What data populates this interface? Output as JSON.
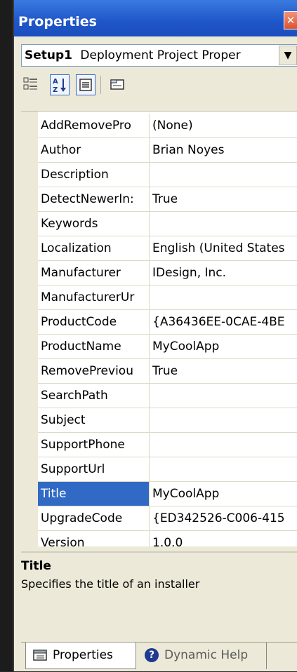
{
  "window": {
    "title": "Properties",
    "close_glyph": "✕"
  },
  "selector": {
    "object": "Setup1",
    "type": "Deployment Project Proper"
  },
  "toolbar": {
    "buttons": [
      {
        "name": "categorized-button",
        "icon": "categorized-icon"
      },
      {
        "name": "alphabetical-button",
        "icon": "alphabetical-icon",
        "glyph": "A↓Z"
      },
      {
        "name": "properties-view-button",
        "icon": "properties-view-icon"
      },
      {
        "name": "property-pages-button",
        "icon": "property-pages-icon"
      }
    ]
  },
  "grid": {
    "rows": [
      {
        "name": "AddRemovePro",
        "value": "(None)"
      },
      {
        "name": "Author",
        "value": "Brian Noyes"
      },
      {
        "name": "Description",
        "value": ""
      },
      {
        "name": "DetectNewerIn:",
        "value": "True"
      },
      {
        "name": "Keywords",
        "value": ""
      },
      {
        "name": "Localization",
        "value": "English (United States"
      },
      {
        "name": "Manufacturer",
        "value": "IDesign, Inc."
      },
      {
        "name": "ManufacturerUr",
        "value": ""
      },
      {
        "name": "ProductCode",
        "value": "{A36436EE-0CAE-4BE"
      },
      {
        "name": "ProductName",
        "value": "MyCoolApp"
      },
      {
        "name": "RemovePreviou",
        "value": "True"
      },
      {
        "name": "SearchPath",
        "value": ""
      },
      {
        "name": "Subject",
        "value": ""
      },
      {
        "name": "SupportPhone",
        "value": ""
      },
      {
        "name": "SupportUrl",
        "value": ""
      },
      {
        "name": "Title",
        "value": "MyCoolApp",
        "selected": true
      },
      {
        "name": "UpgradeCode",
        "value": "{ED342526-C006-415"
      },
      {
        "name": "Version",
        "value": "1.0.0"
      }
    ]
  },
  "description": {
    "title": "Title",
    "text": "Specifies the title of an installer"
  },
  "tabs": [
    {
      "label": "Properties",
      "icon": "properties-tab-icon",
      "active": true
    },
    {
      "label": "Dynamic Help",
      "icon": "help-icon",
      "active": false
    }
  ],
  "colors": {
    "titlebar": "#1f55c8",
    "selection": "#316ac5",
    "window": "#ece9d8"
  }
}
